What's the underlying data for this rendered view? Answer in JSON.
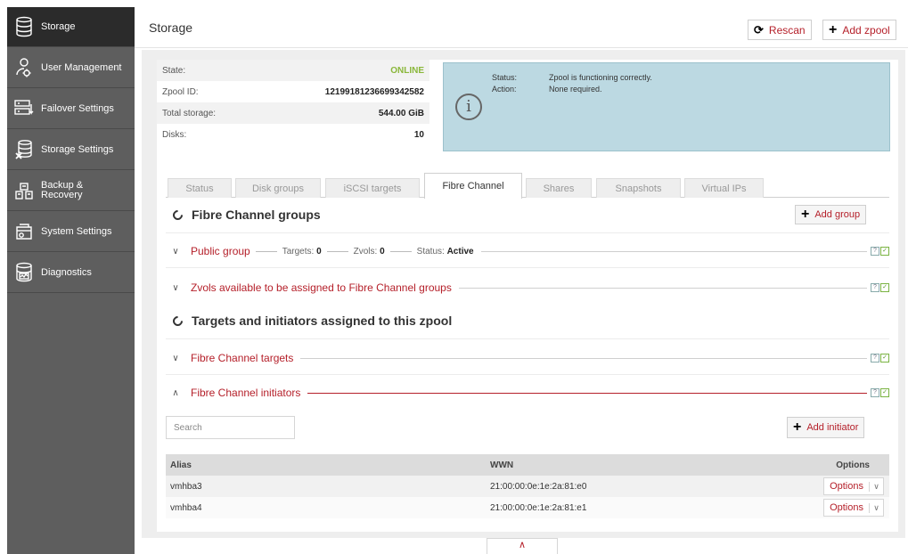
{
  "sidebar": {
    "items": [
      {
        "label": "Storage",
        "icon": "storage-icon",
        "active": true
      },
      {
        "label": "User Management",
        "icon": "user-icon"
      },
      {
        "label": "Failover Settings",
        "icon": "failover-icon"
      },
      {
        "label": "Storage Settings",
        "icon": "storage-settings-icon"
      },
      {
        "label_lines": [
          "Backup &",
          "Recovery"
        ],
        "icon": "backup-icon"
      },
      {
        "label": "System Settings",
        "icon": "system-settings-icon"
      },
      {
        "label": "Diagnostics",
        "icon": "diagnostics-icon"
      }
    ]
  },
  "header": {
    "title": "Storage",
    "rescan_label": "Rescan",
    "add_zpool_label": "Add zpool"
  },
  "zpool_info": {
    "rows": [
      {
        "key": "State:",
        "value": "ONLINE"
      },
      {
        "key": "Zpool ID:",
        "value": "12199181236699342582"
      },
      {
        "key": "Total storage:",
        "value": "544.00 GiB"
      },
      {
        "key": "Disks:",
        "value": "10"
      }
    ]
  },
  "status_box": {
    "status_key": "Status:",
    "status_value": "Zpool is functioning correctly.",
    "action_key": "Action:",
    "action_value": "None required."
  },
  "tabs": [
    "Status",
    "Disk groups",
    "iSCSI targets",
    "Fibre Channel",
    "Shares",
    "Snapshots",
    "Virtual IPs"
  ],
  "active_tab": "Fibre Channel",
  "fc_groups": {
    "title": "Fibre Channel groups",
    "add_group_label": "Add group",
    "public_group": {
      "name": "Public group",
      "targets_label": "Targets:",
      "targets_value": "0",
      "zvols_label": "Zvols:",
      "zvols_value": "0",
      "status_label": "Status:",
      "status_value": "Active"
    },
    "zvols_available": "Zvols available to be assigned to Fibre Channel groups"
  },
  "targets_section": {
    "title": "Targets and initiators assigned to this zpool",
    "fc_targets": "Fibre Channel targets",
    "fc_initiators": "Fibre Channel initiators"
  },
  "initiators": {
    "search_placeholder": "Search",
    "add_initiator_label": "Add initiator",
    "columns": [
      "Alias",
      "WWN",
      "Options"
    ],
    "rows": [
      {
        "alias": "vmhba3",
        "wwn": "21:00:00:0e:1e:2a:81:e0",
        "options": "Options"
      },
      {
        "alias": "vmhba4",
        "wwn": "21:00:00:0e:1e:2a:81:e1",
        "options": "Options"
      }
    ]
  },
  "mini_icons": {
    "info": "?",
    "check": "✓"
  },
  "colors": {
    "accent": "#b5202a",
    "online": "#8ab73a",
    "sidebar": "#5e5e5e",
    "sidebar_active": "#2b2b2b",
    "status_box": "#bcd9e2"
  }
}
